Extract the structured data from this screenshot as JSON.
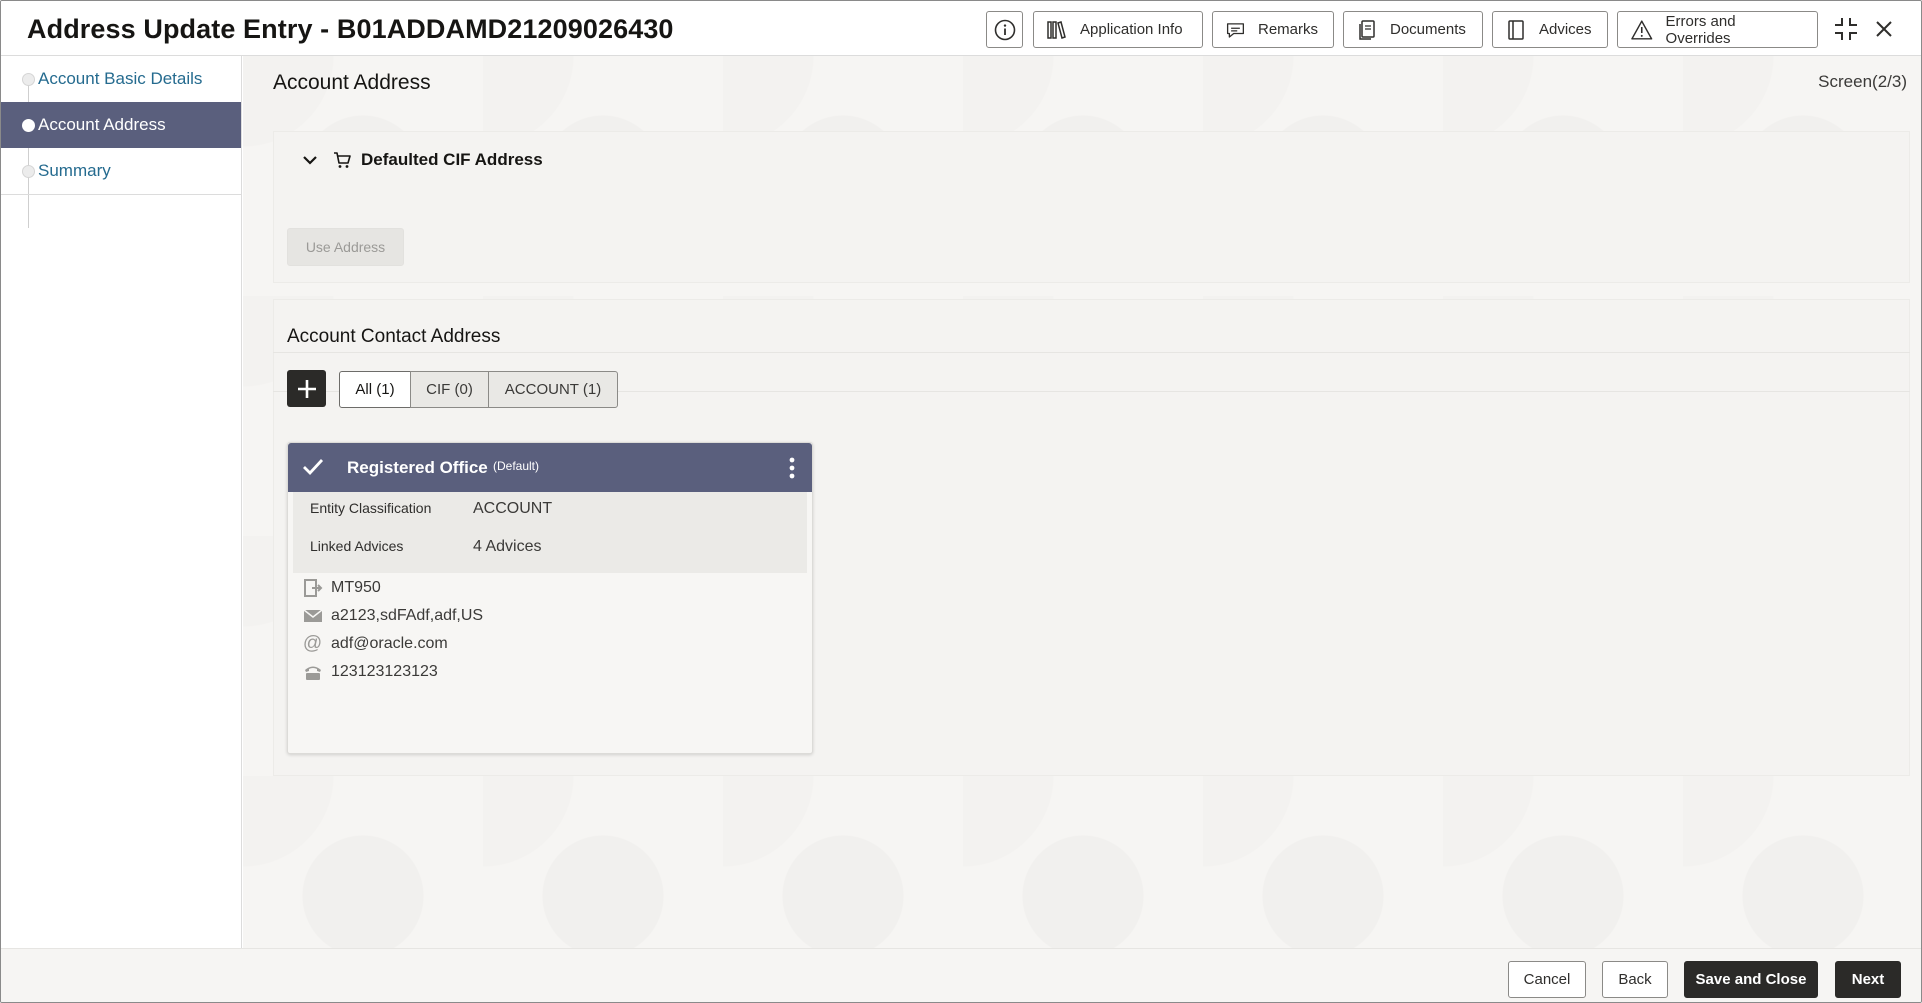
{
  "header": {
    "title": "Address Update Entry - B01ADDAMD21209026430",
    "buttons": {
      "application_info": "Application Info",
      "remarks": "Remarks",
      "documents": "Documents",
      "advices": "Advices",
      "errors_overrides": "Errors and Overrides"
    },
    "icons": [
      "info-icon",
      "library-icon",
      "chat-icon",
      "document-icon",
      "book-icon",
      "warning-icon",
      "minimize-icon",
      "close-icon"
    ]
  },
  "sidebar": {
    "items": [
      {
        "label": "Account Basic Details",
        "active": false
      },
      {
        "label": "Account Address",
        "active": true
      },
      {
        "label": "Summary",
        "active": false
      }
    ]
  },
  "main": {
    "section_title": "Account Address",
    "screen_indicator": "Screen(2/3)",
    "defaulted": {
      "title": "Defaulted CIF Address",
      "use_address_label": "Use Address"
    },
    "contact": {
      "title": "Account Contact Address",
      "tabs": [
        "All (1)",
        "CIF (0)",
        "ACCOUNT (1)"
      ],
      "selected_tab": "All (1)",
      "card": {
        "name": "Registered Office",
        "tag": "(Default)",
        "entity_label": "Entity Classification",
        "entity_value": "ACCOUNT",
        "linked_label": "Linked Advices",
        "linked_value": "4 Advices",
        "media": "MT950",
        "address": "a2123,sdFAdf,adf,US",
        "email": "adf@oracle.com",
        "phone": "123123123123"
      }
    }
  },
  "footer": {
    "cancel": "Cancel",
    "back": "Back",
    "save_close": "Save and Close",
    "next": "Next"
  },
  "colors": {
    "accent": "#5a5f7d",
    "dark_button": "#2b2a28",
    "link": "#256b8f"
  }
}
